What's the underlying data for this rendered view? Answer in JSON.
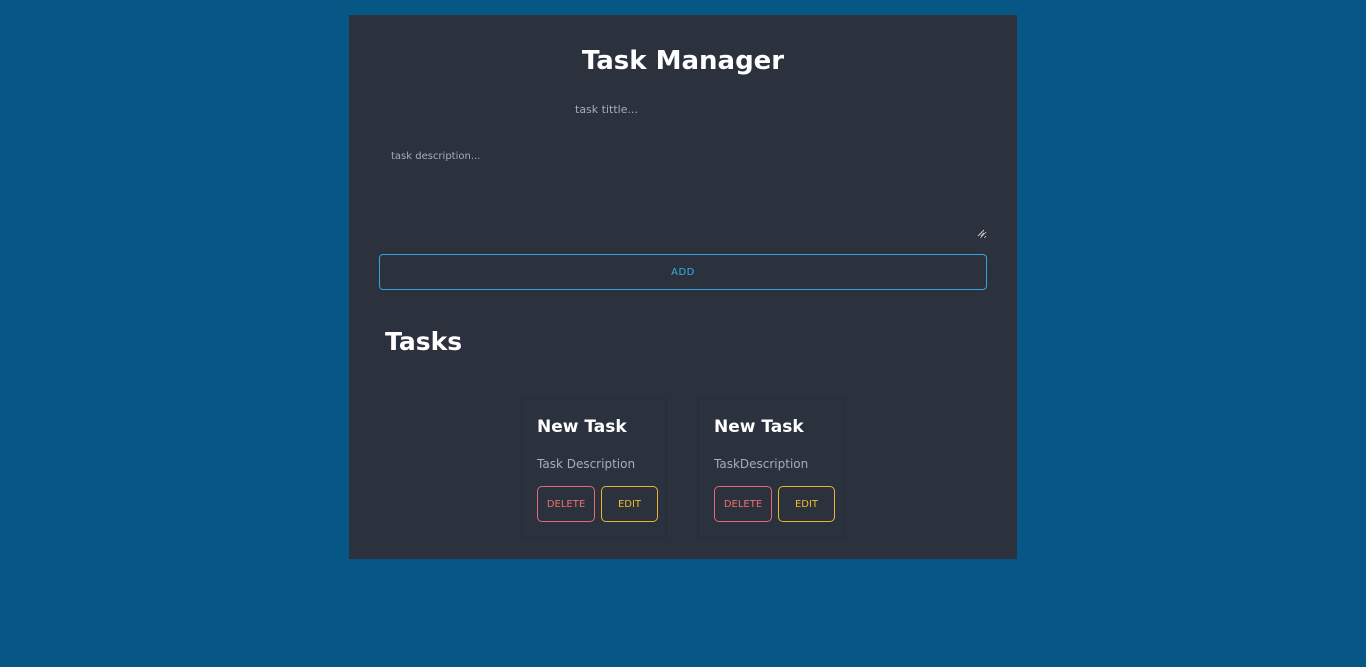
{
  "app": {
    "title": "Task Manager"
  },
  "form": {
    "title_placeholder": "task tittle...",
    "title_value": "",
    "description_placeholder": "task description...",
    "description_value": "",
    "add_label": "ADD"
  },
  "tasks_section": {
    "heading": "Tasks"
  },
  "tasks": [
    {
      "title": "New Task",
      "description": "Task Description",
      "delete_label": "DELETE",
      "edit_label": "EDIT"
    },
    {
      "title": "New Task",
      "description": "TaskDescription",
      "delete_label": "DELETE",
      "edit_label": "EDIT"
    }
  ],
  "colors": {
    "page_background": "#065785",
    "panel_background": "#2b313d",
    "add_accent": "#36aee6",
    "delete_accent": "#ef6f6f",
    "edit_accent": "#f0bd2a"
  }
}
